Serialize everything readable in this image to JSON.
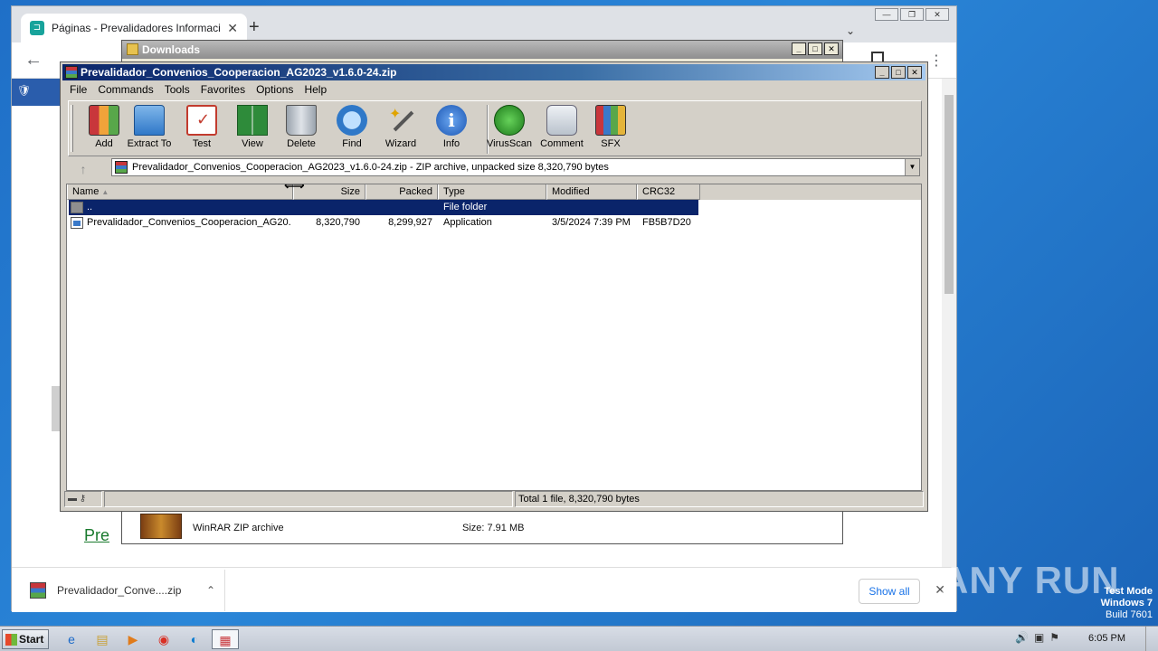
{
  "chrome": {
    "tab_title": "Páginas - Prevalidadores Informacion",
    "page_link_text": "Pre",
    "download_name": "Prevalidador_Conve....zip",
    "show_all": "Show all"
  },
  "downloads_window": {
    "title": "Downloads",
    "file_type": "WinRAR ZIP archive",
    "file_size": "Size: 7.91 MB"
  },
  "winrar": {
    "title": "Prevalidador_Convenios_Cooperacion_AG2023_v1.6.0-24.zip",
    "menu": [
      "File",
      "Commands",
      "Tools",
      "Favorites",
      "Options",
      "Help"
    ],
    "toolbar": [
      {
        "label": "Add",
        "icon": "add-archive-icon"
      },
      {
        "label": "Extract To",
        "icon": "extract-folder-icon"
      },
      {
        "label": "Test",
        "icon": "test-checklist-icon"
      },
      {
        "label": "View",
        "icon": "view-book-icon"
      },
      {
        "label": "Delete",
        "icon": "trash-icon"
      },
      {
        "label": "Find",
        "icon": "magnifier-icon"
      },
      {
        "label": "Wizard",
        "icon": "magic-wand-icon"
      },
      {
        "label": "Info",
        "icon": "info-icon"
      },
      {
        "label": "VirusScan",
        "icon": "virus-scan-icon"
      },
      {
        "label": "Comment",
        "icon": "comment-icon"
      },
      {
        "label": "SFX",
        "icon": "sfx-icon"
      }
    ],
    "address": "Prevalidador_Convenios_Cooperacion_AG2023_v1.6.0-24.zip - ZIP archive, unpacked size 8,320,790 bytes",
    "columns": [
      "Name",
      "Size",
      "Packed",
      "Type",
      "Modified",
      "CRC32"
    ],
    "rows": [
      {
        "name": "..",
        "size": "",
        "packed": "",
        "type": "File folder",
        "modified": "",
        "crc": ""
      },
      {
        "name": "Prevalidador_Convenios_Cooperacion_AG20...",
        "size": "8,320,790",
        "packed": "8,299,927",
        "type": "Application",
        "modified": "3/5/2024 7:39 PM",
        "crc": "FB5B7D20"
      }
    ],
    "status": "Total 1 file, 8,320,790 bytes"
  },
  "watermark": {
    "brand": "ANY RUN",
    "mode": "Test Mode",
    "os": "Windows 7",
    "build": "Build 7601"
  },
  "taskbar": {
    "start": "Start",
    "clock": "6:05 PM"
  }
}
